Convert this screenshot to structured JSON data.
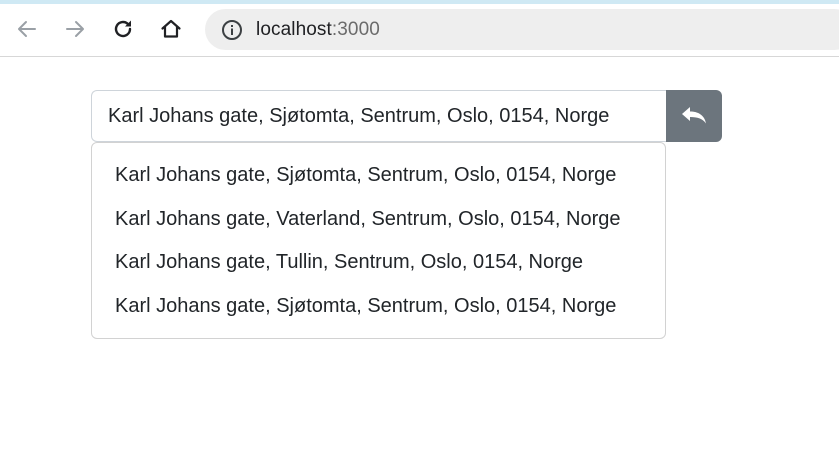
{
  "browser": {
    "url_host": "localhost",
    "url_port": ":3000",
    "icons": {
      "back": "back-arrow-icon",
      "forward": "forward-arrow-icon",
      "reload": "reload-icon",
      "home": "home-icon",
      "info": "info-icon"
    }
  },
  "search": {
    "value": "Karl Johans gate, Sjøtomta, Sentrum, Oslo, 0154, Norge",
    "reset_icon": "undo-icon",
    "reset_color": "#6c757d"
  },
  "suggestions": [
    "Karl Johans gate, Sjøtomta, Sentrum, Oslo, 0154, Norge",
    "Karl Johans gate, Vaterland, Sentrum, Oslo, 0154, Norge",
    "Karl Johans gate, Tullin, Sentrum, Oslo, 0154, Norge",
    "Karl Johans gate, Sjøtomta, Sentrum, Oslo, 0154, Norge"
  ]
}
